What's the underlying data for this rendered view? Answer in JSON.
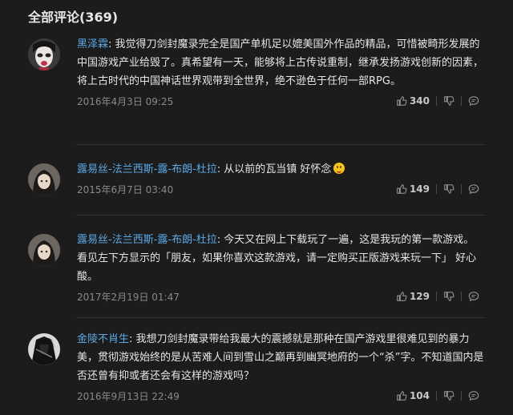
{
  "header": {
    "title": "全部评论(369)"
  },
  "colors": {
    "username": "#5aa9e6",
    "background": "#1c1c1c"
  },
  "comments": [
    {
      "user": "黑泽霖",
      "separator": ": ",
      "content": "我觉得刀剑封魔录完全是国产单机足以媲美国外作品的精品，可惜被畸形发展的中国游戏产业给毁了。真希望有一天，能够将上古传说重制，继承发扬游戏创新的因素，将上古时代的中国神话世界观带到全世界，绝不逊色于任何一部RPG。",
      "time": "2016年4月3日 09:25",
      "likes": "340",
      "avatar_icon": "avatar-pale-face"
    },
    {
      "user": "露易丝-法兰西斯-露-布朗-杜拉",
      "separator": ": ",
      "content": "从以前的瓦当镇 好怀念",
      "emoji": "grinning-tongue-emoji",
      "time": "2015年6月7日 03:40",
      "likes": "149",
      "avatar_icon": "avatar-anime-girl"
    },
    {
      "user": "露易丝-法兰西斯-露-布朗-杜拉",
      "separator": ": ",
      "content": "今天又在网上下载玩了一遍，这是我玩的第一款游戏。 看见左下方显示的「朋友，如果你喜欢这款游戏，请一定购买正版游戏来玩一下」 好心酸。",
      "time": "2017年2月19日 01:47",
      "likes": "129",
      "avatar_icon": "avatar-anime-girl"
    },
    {
      "user": "金陵不肖生",
      "separator": ": ",
      "content": "我想刀剑封魔录带给我最大的震撼就是那种在国产游戏里很难见到的暴力美，贯彻游戏始终的是从苦难人间到雪山之巅再到幽冥地府的一个“杀”字。不知道国内是否还曾有抑或者还会有这样的游戏吗？",
      "time": "2016年9月13日 22:49",
      "likes": "104",
      "avatar_icon": "avatar-dark-figure"
    }
  ]
}
